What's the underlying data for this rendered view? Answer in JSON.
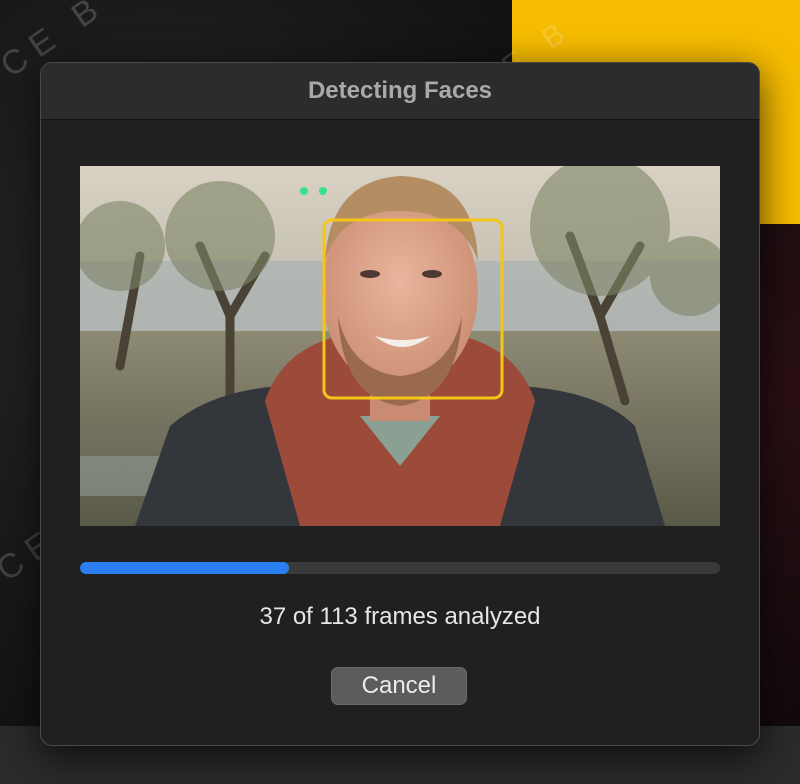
{
  "dialog": {
    "title": "Detecting Faces",
    "status_text": "37 of 113 frames analyzed",
    "frames_analyzed": 37,
    "frames_total": 113,
    "progress_fraction": 0.327,
    "cancel_label": "Cancel"
  },
  "background": {
    "watermark_text": "CE B"
  },
  "colors": {
    "accent_progress": "#2a7ff0",
    "face_box": "#f5c518",
    "background_highlight": "#f7bd00"
  }
}
